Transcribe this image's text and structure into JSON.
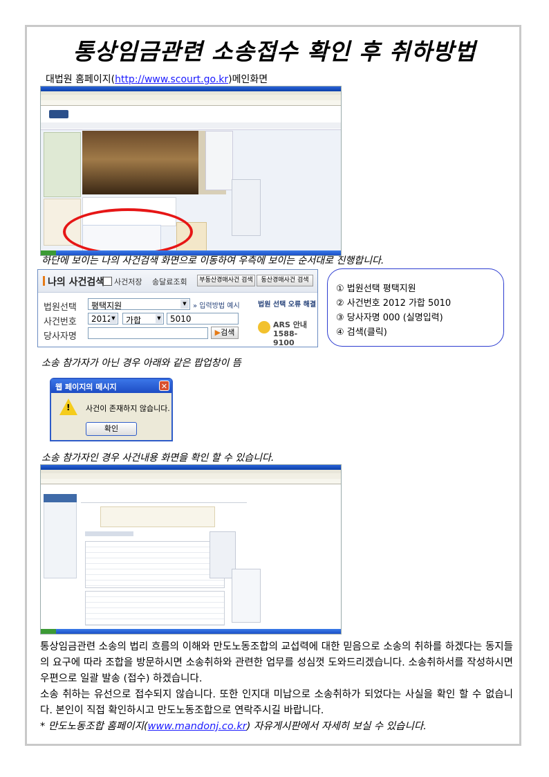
{
  "title": "통상임금관련 소송접수 확인 후 취하방법",
  "subtitle": {
    "prefix": "대법원 홈페이지(",
    "url": "http://www.scourt.go.kr",
    "suffix": ")메인화면"
  },
  "caption1": "하단에 보이는 나의 사건검색 화면으로 이동하여 우측에 보이는 순서대로 진행합니다.",
  "search_panel": {
    "header": "나의 사건검색",
    "checkbox_label": "사건저장",
    "link1": "송달료조회",
    "button1": "부동산경매사건 검색",
    "button2": "동산경매사건 검색",
    "court_label": "법원선택",
    "court_value": "평택지원",
    "input_method": "» 입력방법 예시",
    "court_error": "법원 선택 오류 해결",
    "case_label": "사건번호",
    "year": "2012",
    "case_type": "가합",
    "case_no": "5010",
    "party_label": "당사자명",
    "search_button": "검색",
    "ars_title": "ARS 안내",
    "ars_number": "1588-9100"
  },
  "steps": [
    "① 법원선택 평택지원",
    "② 사건번호 2012 가합 5010",
    "③ 당사자명 000 (실명입력)",
    "④ 검색(클릭)"
  ],
  "caption2": "소송 참가자가 아닌 경우 아래와 같은 팝업창이 뜸",
  "dialog": {
    "title": "웹 페이지의 메시지",
    "message": "사건이 존재하지 않습니다.",
    "ok": "확인"
  },
  "caption3": "소송 참가자인 경우 사건내용 화면을 확인 할 수 있습니다.",
  "paragraph1": "통상임금관련 소송의 법리 흐름의 이해와 만도노동조합의 교섭력에 대한 믿음으로 소송의 취하를 하겠다는 동지들의 요구에 따라 조합을 방문하시면 소송취하와 관련한 업무를 성심껏 도와드리겠습니다. 소송취하서를 작성하시면 우편으로 일괄 발송 (접수) 하겠습니다.",
  "paragraph2": "소송 취하는 유선으로 접수되지 않습니다. 또한 인지대 미납으로 소송취하가 되었다는 사실을 확인 할 수 없습니다. 본인이 직접 확인하시고 만도노동조합으로 연락주시길 바랍니다.",
  "footer": {
    "prefix": "* 만도노동조합 홈페이지(",
    "url": "www.mandonj.co.kr",
    "suffix": ") 자유게시판에서 자세히 보실 수 있습니다."
  },
  "colors": {
    "accent_red": "#e61616",
    "link_blue": "#1a1aff",
    "ie_blue": "#0b3fa8"
  }
}
